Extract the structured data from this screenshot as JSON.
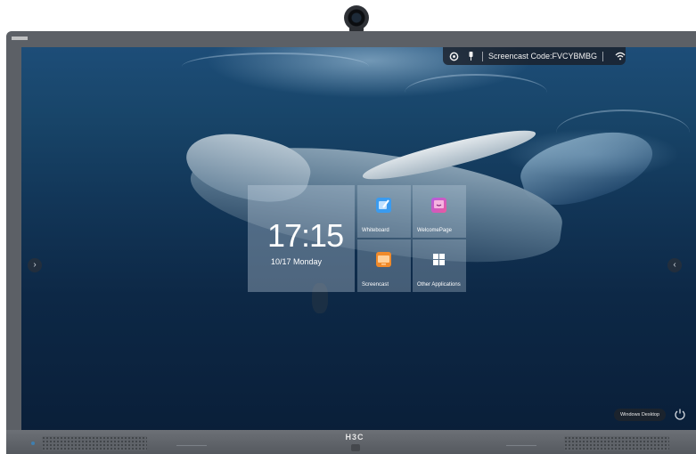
{
  "device": {
    "brand": "H3C"
  },
  "status_bar": {
    "screencast_label": "Screencast Code:FVCYBMBG",
    "icons": [
      "settings-icon",
      "pin-icon",
      "wifi-icon"
    ]
  },
  "clock": {
    "time": "17:15",
    "date": "10/17  Monday"
  },
  "apps": [
    {
      "label": "Whiteboard",
      "icon": "whiteboard-icon",
      "color": "#3a9bef"
    },
    {
      "label": "WelcomePage",
      "icon": "welcome-page-icon",
      "color": "#d85ac8"
    },
    {
      "label": "Screencast",
      "icon": "screencast-icon",
      "color": "#f08a2a"
    },
    {
      "label": "Other Applications",
      "icon": "grid-icon",
      "color": "#ffffff"
    }
  ],
  "navigation": {
    "prev_glyph": "›",
    "next_glyph": "‹"
  },
  "bottom": {
    "desktop_button": "Windows Desktop",
    "power_icon": "power-icon"
  }
}
